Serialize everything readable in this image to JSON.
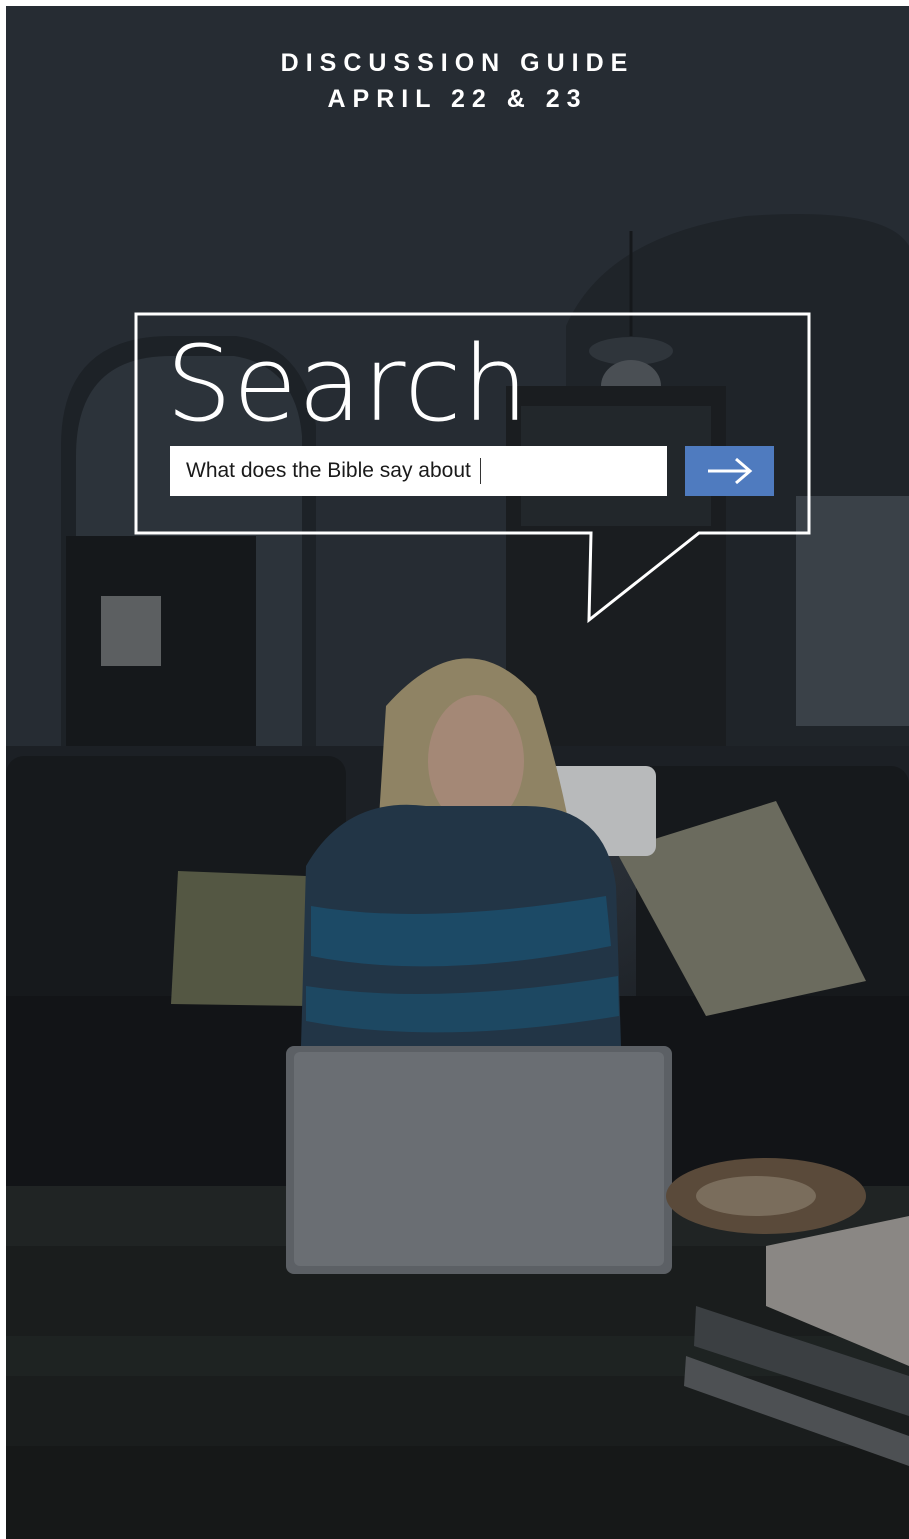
{
  "header": {
    "line1": "DISCUSSION GUIDE",
    "line2": "APRIL 22 & 23"
  },
  "title": "Search",
  "search": {
    "value": "What does the Bible say about"
  },
  "search_button": {
    "icon": "arrow-right-icon"
  },
  "colors": {
    "background": "#272d34",
    "text": "#ffffff",
    "button": "#4f7bbf",
    "input": "#ffffff"
  }
}
